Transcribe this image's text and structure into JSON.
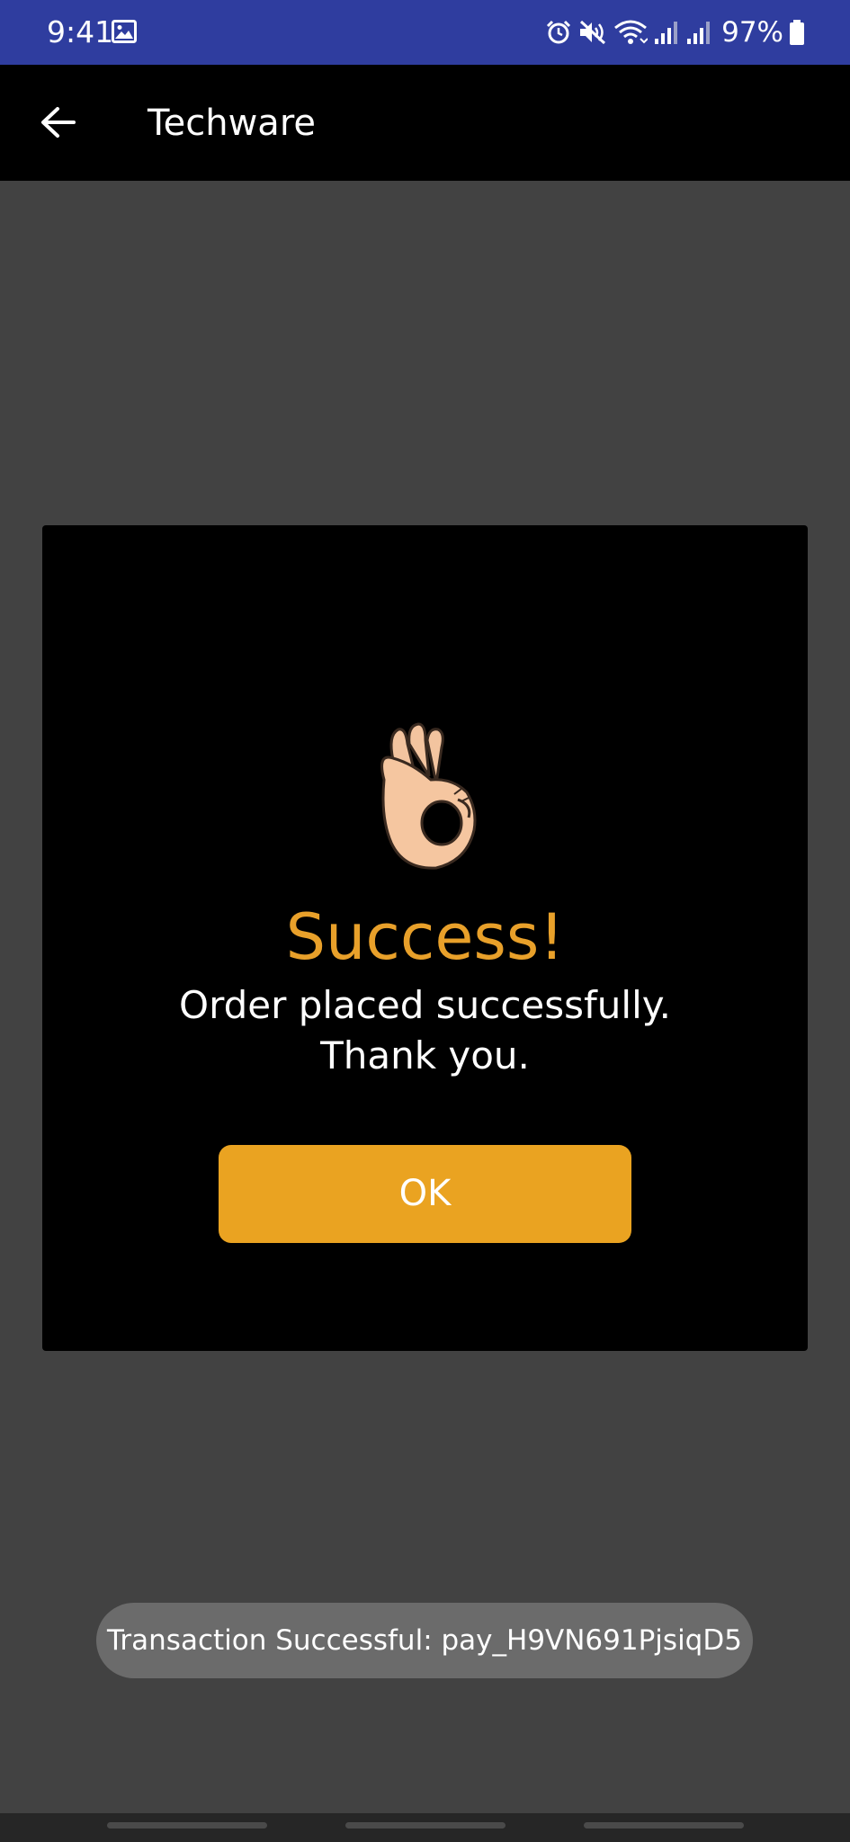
{
  "status_bar": {
    "time": "9:41",
    "battery": "97%",
    "colors": {
      "background": "#2f3d9f"
    }
  },
  "app_bar": {
    "title": "Techware",
    "back_icon": "arrow-left-icon"
  },
  "dialog": {
    "icon": "ok-hand-icon",
    "title": "Success!",
    "message_lines": [
      "Order placed successfully.",
      "Thank you."
    ],
    "ok_label": "OK",
    "colors": {
      "title": "#e8a02a",
      "button": "#eaa321"
    }
  },
  "toast": {
    "text": "Transaction Successful: pay_H9VN691PjsiqD5"
  },
  "nav_bar": {
    "handles": [
      "left",
      "center",
      "right"
    ]
  }
}
